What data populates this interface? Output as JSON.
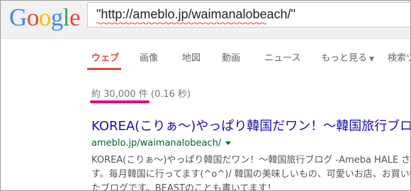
{
  "logo": {
    "letters": [
      {
        "char": "G",
        "color": "#4285f4"
      },
      {
        "char": "o",
        "color": "#ea4335"
      },
      {
        "char": "o",
        "color": "#fbbc05"
      },
      {
        "char": "g",
        "color": "#4285f4"
      },
      {
        "char": "l",
        "color": "#34a853"
      },
      {
        "char": "e",
        "color": "#ea4335"
      }
    ],
    "text": "Google"
  },
  "search": {
    "query": "\"http://ameblo.jp/waimanalobeach/\""
  },
  "tabs": [
    {
      "label": "ウェブ",
      "active": true
    },
    {
      "label": "画像"
    },
    {
      "label": "地図"
    },
    {
      "label": "動画"
    },
    {
      "label": "ニュース"
    },
    {
      "label": "もっと見る"
    },
    {
      "label": "検索ツー"
    }
  ],
  "stats": "約 30,000 件 (0.16 秒)",
  "result": {
    "title": "KOREA(こりぁ〜)やっぱり韓国だワン！〜韓国旅行ブログ",
    "url": "ameblo.jp/waimanalobeach/",
    "snippet": [
      "KOREA(こりぁ〜)やっぱり韓国だワン！〜韓国旅行ブログ -Ameba HALE さんの",
      "す。毎月韓国に行ってます(^o^)/ 韓国の美味しいもの、可愛いお店、お買い物を",
      "たブログです。BEASTのことも書いてます！"
    ]
  },
  "colors": {
    "accent": "#dd4b39",
    "link": "#1a0dab",
    "url": "#006621",
    "highlight": "#e6007e"
  }
}
